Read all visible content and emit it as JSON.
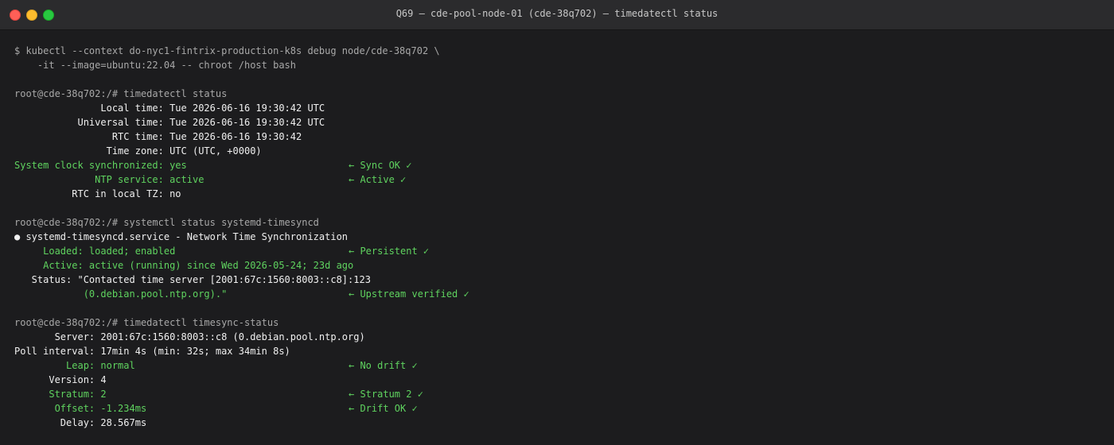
{
  "window": {
    "title": "Q69 — cde-pool-node-01 (cde-38q702) — timedatectl status"
  },
  "terminal": {
    "lines": [
      {
        "text": "$ kubectl --context do-nyc1-fintrix-production-k8s debug node/cde-38q702 \\",
        "style": "dim"
      },
      {
        "text": "    -it --image=ubuntu:22.04 -- chroot /host bash",
        "style": "dim"
      },
      {
        "text": "",
        "style": "blank"
      },
      {
        "text": "root@cde-38q702:/# timedatectl status",
        "style": "dim"
      },
      {
        "text": "               Local time: Tue 2026-06-16 19:30:42 UTC",
        "style": "white"
      },
      {
        "text": "           Universal time: Tue 2026-06-16 19:30:42 UTC",
        "style": "white"
      },
      {
        "text": "                 RTC time: Tue 2026-06-16 19:30:42",
        "style": "white"
      },
      {
        "text": "                Time zone: UTC (UTC, +0000)",
        "style": "white"
      },
      {
        "text": "System clock synchronized: yes",
        "style": "green",
        "note": "← Sync OK ✓"
      },
      {
        "text": "              NTP service: active",
        "style": "green",
        "note": "← Active ✓"
      },
      {
        "text": "          RTC in local TZ: no",
        "style": "white"
      },
      {
        "text": "",
        "style": "blank"
      },
      {
        "text": "root@cde-38q702:/# systemctl status systemd-timesyncd",
        "style": "dim"
      },
      {
        "text": "● systemd-timesyncd.service - Network Time Synchronization",
        "style": "white"
      },
      {
        "text": "     Loaded: loaded; enabled",
        "style": "green",
        "note": "← Persistent ✓"
      },
      {
        "text": "     Active: active (running) since Wed 2026-05-24; 23d ago",
        "style": "green"
      },
      {
        "text": "   Status: \"Contacted time server [2001:67c:1560:8003::c8]:123",
        "style": "white"
      },
      {
        "text": "            (0.debian.pool.ntp.org).\"",
        "style": "green",
        "note": "← Upstream verified ✓"
      },
      {
        "text": "",
        "style": "blank"
      },
      {
        "text": "root@cde-38q702:/# timedatectl timesync-status",
        "style": "dim"
      },
      {
        "text": "       Server: 2001:67c:1560:8003::c8 (0.debian.pool.ntp.org)",
        "style": "white"
      },
      {
        "text": "Poll interval: 17min 4s (min: 32s; max 34min 8s)",
        "style": "white"
      },
      {
        "text": "         Leap: normal",
        "style": "green",
        "note": "← No drift ✓"
      },
      {
        "text": "      Version: 4",
        "style": "white"
      },
      {
        "text": "      Stratum: 2",
        "style": "green",
        "note": "← Stratum 2 ✓"
      },
      {
        "text": "       Offset: -1.234ms",
        "style": "green",
        "note": "← Drift OK ✓"
      },
      {
        "text": "        Delay: 28.567ms",
        "style": "white"
      }
    ]
  },
  "colors": {
    "background": "#1c1c1e",
    "titlebar": "#2b2b2d",
    "prompt": "#a8a8a8",
    "output": "#f0f0f0",
    "ok": "#5fd35f"
  }
}
